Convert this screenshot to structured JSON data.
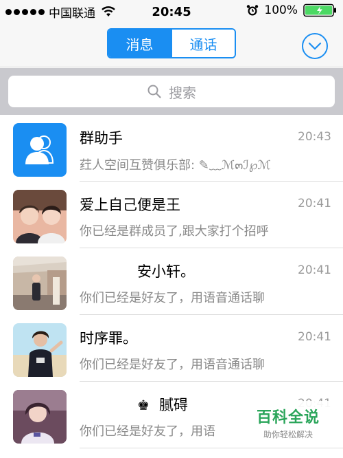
{
  "status_bar": {
    "carrier": "中国联通",
    "time": "20:45",
    "battery": "100%"
  },
  "nav": {
    "tabs": [
      {
        "label": "消息",
        "active": true
      },
      {
        "label": "通话",
        "active": false
      }
    ],
    "accent_color": "#1a8ef2"
  },
  "search": {
    "placeholder": "搜索"
  },
  "conversations": [
    {
      "title": "群助手",
      "time": "20:43",
      "message": "荭人空间互赞俱乐部: ✎﹏ℳ๓ℐ℘ℳ",
      "avatar": "group-helper-icon"
    },
    {
      "title": "爱上自己便是王",
      "time": "20:41",
      "message": "你已经是群成员了,跟大家打个招呼",
      "avatar": "couple-photo"
    },
    {
      "title": "安小轩。",
      "time": "20:41",
      "message": "你们已经是好友了，用语音通话聊",
      "avatar": "subway-photo"
    },
    {
      "title": "时序罪。",
      "time": "20:41",
      "message": "你们已经是好友了，用语音通话聊",
      "avatar": "beach-photo"
    },
    {
      "title": "腻碍",
      "time": "20:41",
      "message": "你们已经是好友了，用语",
      "avatar": "girl-photo",
      "prefix_icon": "crown-icon"
    }
  ],
  "watermark": {
    "title": "百科全说",
    "subtitle": "助你轻松解决"
  }
}
